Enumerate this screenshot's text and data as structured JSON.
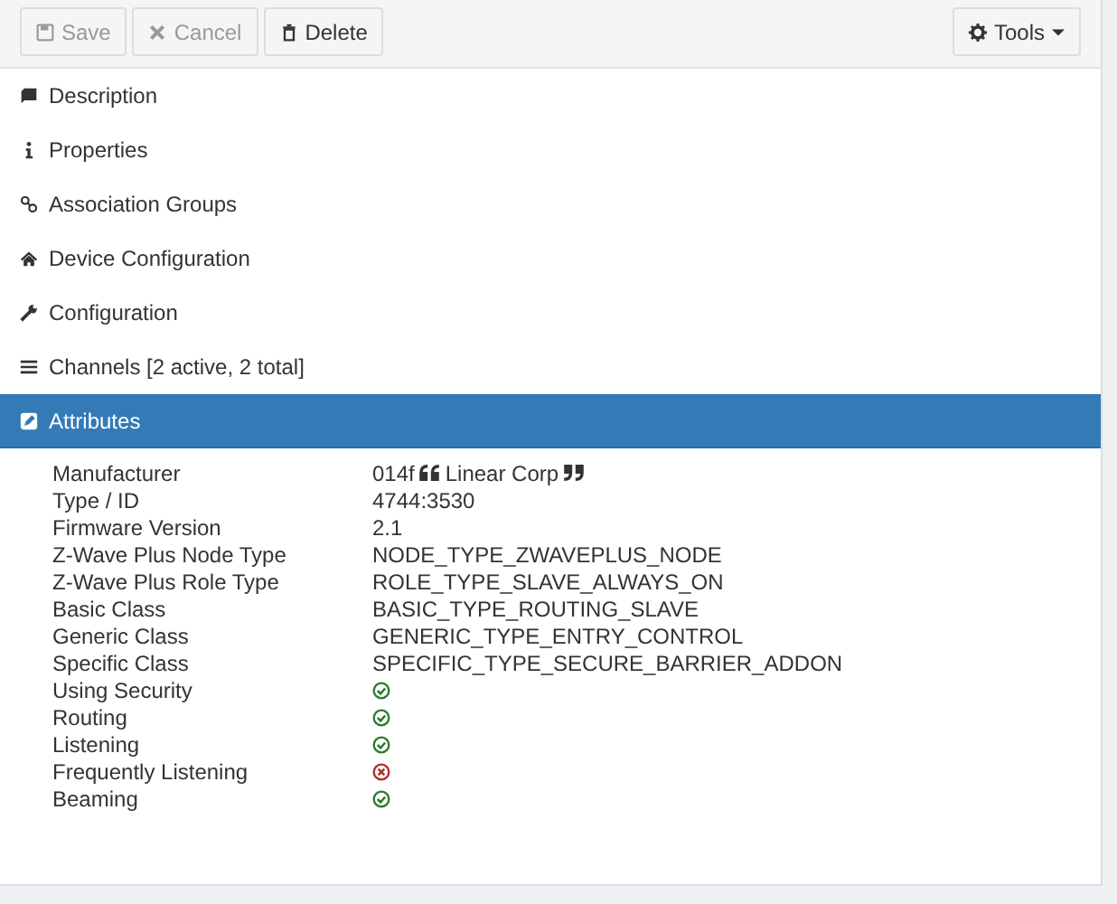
{
  "toolbar": {
    "buttons": [
      {
        "label": "Save",
        "disabled": true
      },
      {
        "label": "Cancel",
        "disabled": true
      },
      {
        "label": "Delete",
        "disabled": false
      }
    ],
    "tools": {
      "label": "Tools"
    }
  },
  "sections": [
    {
      "label": "Description",
      "selected": false
    },
    {
      "label": "Properties",
      "selected": false
    },
    {
      "label": "Association Groups",
      "selected": false
    },
    {
      "label": "Device Configuration",
      "selected": false
    },
    {
      "label": "Configuration",
      "selected": false
    },
    {
      "label": "Channels [2 active, 2 total]",
      "selected": false
    },
    {
      "label": "Attributes",
      "selected": true
    }
  ],
  "attributes": [
    {
      "kind": "manufacturer",
      "label": "Manufacturer",
      "code": "014f",
      "name": "Linear Corp"
    },
    {
      "kind": "text",
      "label": "Type / ID",
      "value": "4744:3530"
    },
    {
      "kind": "text",
      "label": "Firmware Version",
      "value": "2.1"
    },
    {
      "kind": "text",
      "label": "Z-Wave Plus Node Type",
      "value": "NODE_TYPE_ZWAVEPLUS_NODE"
    },
    {
      "kind": "text",
      "label": "Z-Wave Plus Role Type",
      "value": "ROLE_TYPE_SLAVE_ALWAYS_ON"
    },
    {
      "kind": "text",
      "label": "Basic Class",
      "value": "BASIC_TYPE_ROUTING_SLAVE"
    },
    {
      "kind": "text",
      "label": "Generic Class",
      "value": "GENERIC_TYPE_ENTRY_CONTROL"
    },
    {
      "kind": "text",
      "label": "Specific Class",
      "value": "SPECIFIC_TYPE_SECURE_BARRIER_ADDON"
    },
    {
      "kind": "flag",
      "label": "Using Security",
      "on": true
    },
    {
      "kind": "flag",
      "label": "Routing",
      "on": true
    },
    {
      "kind": "flag",
      "label": "Listening",
      "on": true
    },
    {
      "kind": "flag",
      "label": "Frequently Listening",
      "on": false
    },
    {
      "kind": "flag",
      "label": "Beaming",
      "on": true
    }
  ]
}
